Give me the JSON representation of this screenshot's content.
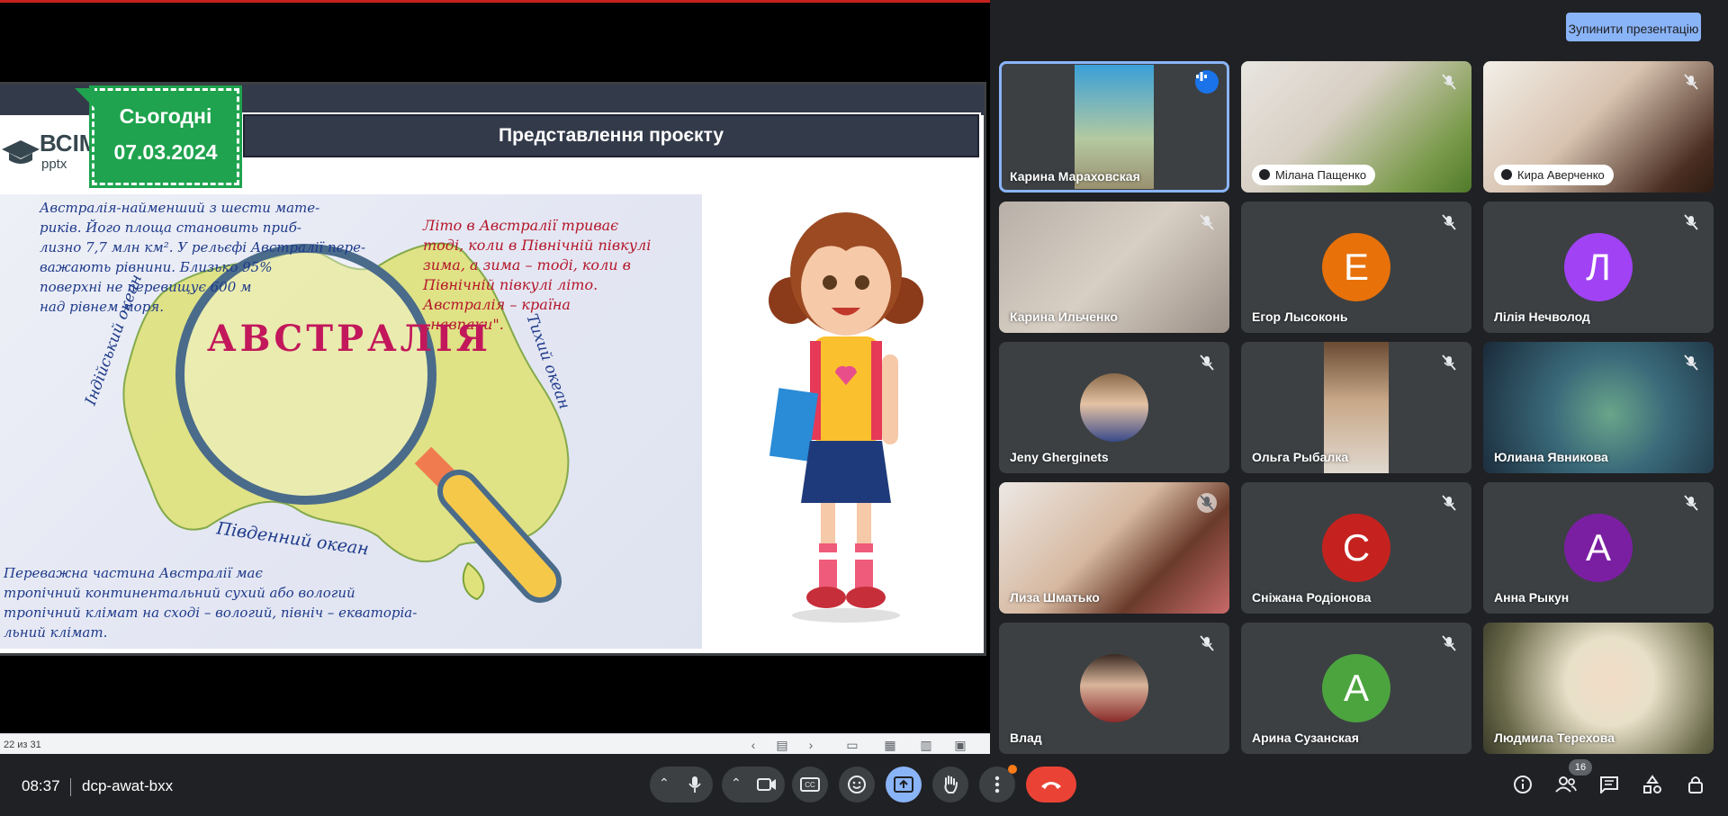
{
  "slide": {
    "date_label": "Сьогодні",
    "date_value": "07.03.2024",
    "logo_brand": "ВСІМ",
    "logo_sub": "pptx",
    "title": "Представлення проєкту",
    "map_word": "АВСТРАЛІЯ",
    "ocean_indian": "Індійський океан",
    "ocean_pacific": "Тихий океан",
    "ocean_southern": "Південний океан",
    "note_top_left": [
      "Австралія-найменший з шести мате-",
      "риків. Його площа становить приб-",
      "лизно 7,7 млн км². У рельєфі Австралії пере-",
      "важають рівнини. Близько 95%",
      "поверхні не перевищує 600 м",
      "над рівнем моря."
    ],
    "note_top_right": [
      "Літо в Австралії триває",
      "тоді, коли в Північній півкулі",
      "зима, а зима – тоді, коли в",
      "Північній півкулі літо.",
      "Австралія – країна",
      "„навпаки\"."
    ],
    "note_bottom": [
      "Переважна частина Австралії має",
      "тропічний континентальний сухий або вологий",
      "тропічний клімат на сході – вологий, північ – екваторіа-",
      "льний клімат."
    ],
    "counter": "22 из 31"
  },
  "panel": {
    "stop_button": "Зупинити презентацію",
    "participants": [
      {
        "name": "Карина Мараховская",
        "speaking": true
      },
      {
        "name": "Мілана Пащенко"
      },
      {
        "name": "Кира Аверченко"
      },
      {
        "name": "Карина Ильченко"
      },
      {
        "name": "Егор Лысоконь",
        "initial": "Е",
        "color": "#e8710a"
      },
      {
        "name": "Лілія Нечволод",
        "initial": "Л",
        "color": "#a142f4"
      },
      {
        "name": "Jeny Gherginets"
      },
      {
        "name": "Ольга Рыбалка"
      },
      {
        "name": "Юлиана Явникова"
      },
      {
        "name": "Лиза Шматько"
      },
      {
        "name": "Сніжана Родіонова",
        "initial": "С",
        "color": "#c5221f"
      },
      {
        "name": "Анна Рыкун",
        "initial": "А",
        "color": "#7b1fa2"
      },
      {
        "name": "Влад"
      },
      {
        "name": "Арина Сузанская",
        "initial": "А",
        "color": "#4ca43f"
      },
      {
        "name": "Людмила Терехова"
      }
    ]
  },
  "bottombar": {
    "time": "08:37",
    "meeting_code": "dcp-awat-bxx",
    "participants_count": "16"
  }
}
